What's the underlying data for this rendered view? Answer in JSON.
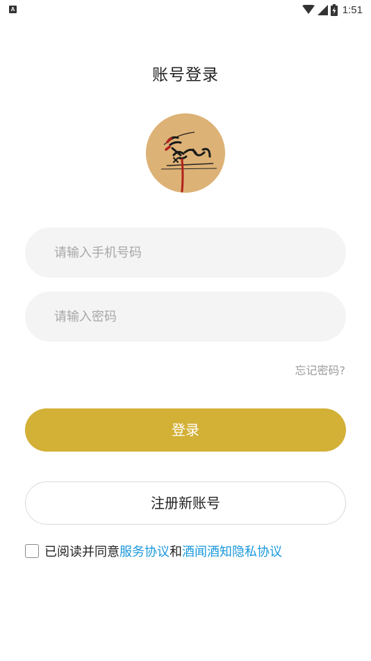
{
  "status_bar": {
    "indicator": "A",
    "time": "1:51",
    "icons": [
      "wifi-icon",
      "signal-icon",
      "battery-charging-icon"
    ]
  },
  "header": {
    "title": "账号登录"
  },
  "logo": {
    "name": "酒闻酒知 logo"
  },
  "form": {
    "phone_placeholder": "请输入手机号码",
    "password_placeholder": "请输入密码",
    "forgot_label": "忘记密码?",
    "login_label": "登录",
    "register_label": "注册新账号"
  },
  "agreement": {
    "checked": false,
    "prefix": "已阅读并同意",
    "service_link": "服务协议",
    "joiner": "和",
    "privacy_link": "酒闻酒知隐私协议"
  },
  "colors": {
    "primary": "#d3b036",
    "link": "#1a98dc",
    "logo_bg": "#ddb276",
    "input_bg": "#f4f4f4"
  }
}
